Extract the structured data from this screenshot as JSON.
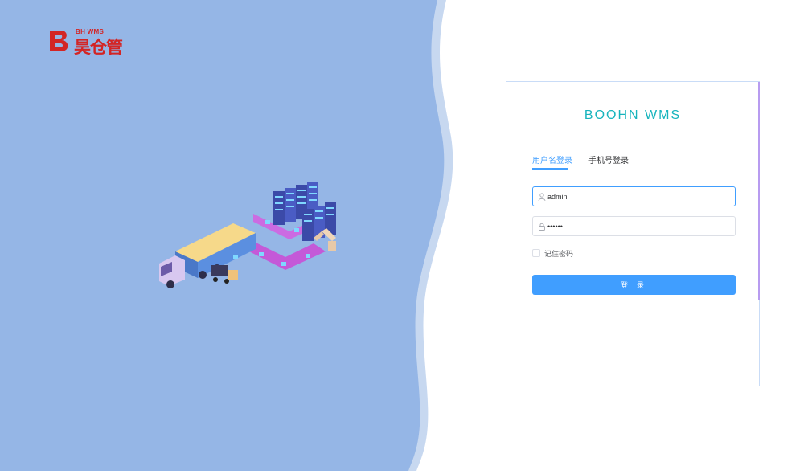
{
  "brand": {
    "logo_sub": "BH WMS",
    "logo_cn": "昊仓管",
    "color": "#d32525"
  },
  "login": {
    "title": "BOOHN WMS",
    "tabs": [
      {
        "label": "用户名登录",
        "active": true
      },
      {
        "label": "手机号登录",
        "active": false
      }
    ],
    "username": {
      "value": "admin",
      "icon": "user-icon"
    },
    "password": {
      "value": "••••••",
      "icon": "lock-icon"
    },
    "remember_label": "记住密码",
    "submit_label": "登 录",
    "accent": "#409eff",
    "title_color": "#17b4bd"
  },
  "background": {
    "panel_color": "#95b6e6"
  }
}
